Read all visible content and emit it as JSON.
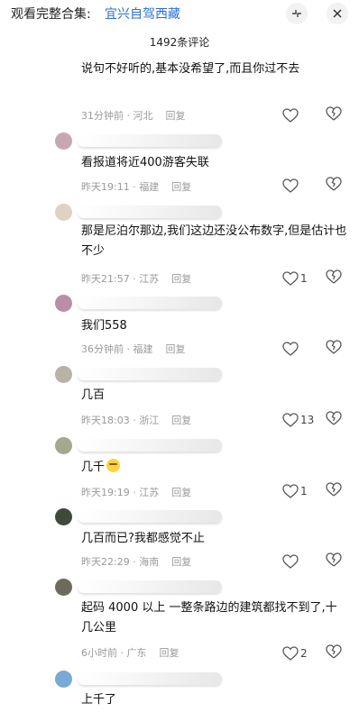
{
  "header": {
    "prefix": "观看完整合集:",
    "collection": "宜兴自驾西藏"
  },
  "comment_count": "1492条评论",
  "comments": [
    {
      "text": "说句不好听的,基本没希望了,而且你过不去",
      "time": "31分钟前",
      "location": "河北",
      "reply": "回复",
      "likes": ""
    },
    {
      "text": "看报道将近400游客失联",
      "time": "昨天19:11",
      "location": "福建",
      "reply": "回复",
      "likes": ""
    },
    {
      "text": "那是尼泊尔那边,我们这边还没公布数字,但是估计也不少",
      "time": "昨天21:57",
      "location": "江苏",
      "reply": "回复",
      "likes": "1"
    },
    {
      "text": "我们558",
      "time": "36分钟前",
      "location": "福建",
      "reply": "回复",
      "likes": ""
    },
    {
      "text": "几百",
      "time": "昨天18:03",
      "location": "浙江",
      "reply": "回复",
      "likes": "13"
    },
    {
      "text": "几千",
      "time": "昨天19:19",
      "location": "江苏",
      "reply": "回复",
      "likes": "1"
    },
    {
      "text": "几百而已?我都感觉不止",
      "time": "昨天22:29",
      "location": "海南",
      "reply": "回复",
      "likes": ""
    },
    {
      "text": "起码 4000 以上 一整条路边的建筑都找不到了,十几公里",
      "time": "6小时前",
      "location": "广东",
      "reply": "回复",
      "likes": "2"
    },
    {
      "text": "上千了",
      "time": "",
      "location": "",
      "reply": "",
      "likes": ""
    }
  ],
  "colors": {
    "accent": "#2a6fd6",
    "meta": "#9a9a9a"
  },
  "icons": {
    "like": "heart-outline-icon",
    "dislike": "broken-heart-icon",
    "collapse": "collapse-arrows-icon",
    "close": "close-icon",
    "emoji": "sleepy-face-emoji"
  }
}
